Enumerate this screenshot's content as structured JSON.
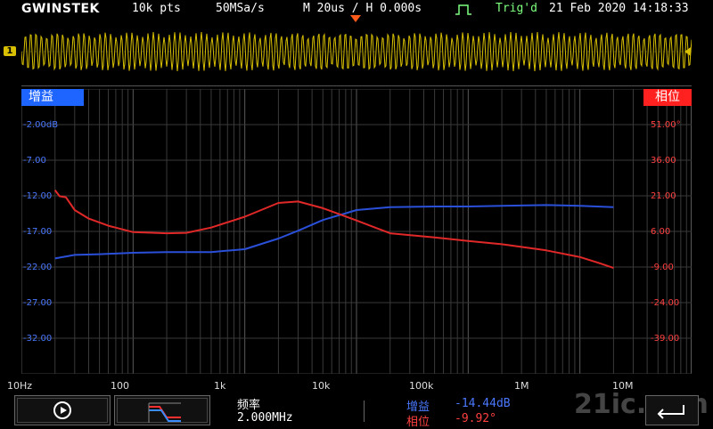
{
  "header": {
    "brand": "GWINSTEK",
    "points": "10k pts",
    "sample_rate": "50MSa/s",
    "timebase": "M 20us / H 0.000s",
    "trigger_status": "Trig'd",
    "datetime": "21 Feb 2020 14:18:33"
  },
  "channel": {
    "marker": "1",
    "color": "#d8c000"
  },
  "bode": {
    "gain_tag": "增益",
    "phase_tag": "相位",
    "gain_ticks": [
      "-2.00dB",
      "-7.00",
      "-12.00",
      "-17.00",
      "-22.00",
      "-27.00",
      "-32.00"
    ],
    "phase_ticks": [
      "51.00°",
      "36.00",
      "21.00",
      "6.00",
      "-9.00",
      "-24.00",
      "-39.00"
    ],
    "freq_ticks": [
      "10Hz",
      "100",
      "1k",
      "10k",
      "100k",
      "1M",
      "10M"
    ],
    "gain_color": "#2a4fd8",
    "phase_color": "#e02828"
  },
  "chart_data": {
    "type": "line",
    "xscale": "log",
    "xlim": [
      10,
      10000000
    ],
    "series": [
      {
        "name": "增益",
        "axis": "left",
        "ylim": [
          -38,
          2
        ],
        "x": [
          20,
          30,
          50,
          100,
          200,
          500,
          1000,
          2000,
          3000,
          5000,
          10000,
          20000,
          50000,
          100000,
          200000,
          500000,
          1000000,
          2000000
        ],
        "y": [
          -21.8,
          -21.3,
          -21.2,
          -21.0,
          -20.9,
          -20.9,
          -20.5,
          -19.0,
          -17.9,
          -16.4,
          -15.0,
          -14.6,
          -14.5,
          -14.5,
          -14.4,
          -14.3,
          -14.4,
          -14.6
        ]
      },
      {
        "name": "相位",
        "axis": "right",
        "ylim": [
          -54,
          66
        ],
        "x": [
          20,
          22,
          25,
          30,
          40,
          60,
          100,
          200,
          300,
          500,
          1000,
          2000,
          3000,
          5000,
          10000,
          20000,
          50000,
          100000,
          200000,
          500000,
          1000000,
          1500000,
          2000000
        ],
        "y": [
          23.4,
          20.8,
          20.4,
          15.0,
          11.4,
          8.4,
          5.7,
          5.2,
          5.4,
          7.6,
          12.2,
          18.0,
          18.6,
          15.8,
          10.6,
          5.2,
          3.5,
          2.0,
          0.6,
          -2.0,
          -4.8,
          -7.4,
          -9.4
        ]
      }
    ]
  },
  "softkeys": {
    "play_icon": "play-icon",
    "filter_icon": "filter-icon"
  },
  "readout": {
    "freq_label": "频率",
    "freq_value": "2.000MHz",
    "gain_label": "增益",
    "gain_value": "-14.44dB",
    "phase_label": "相位",
    "phase_value": "-9.92°"
  },
  "watermark": "21ic.com"
}
